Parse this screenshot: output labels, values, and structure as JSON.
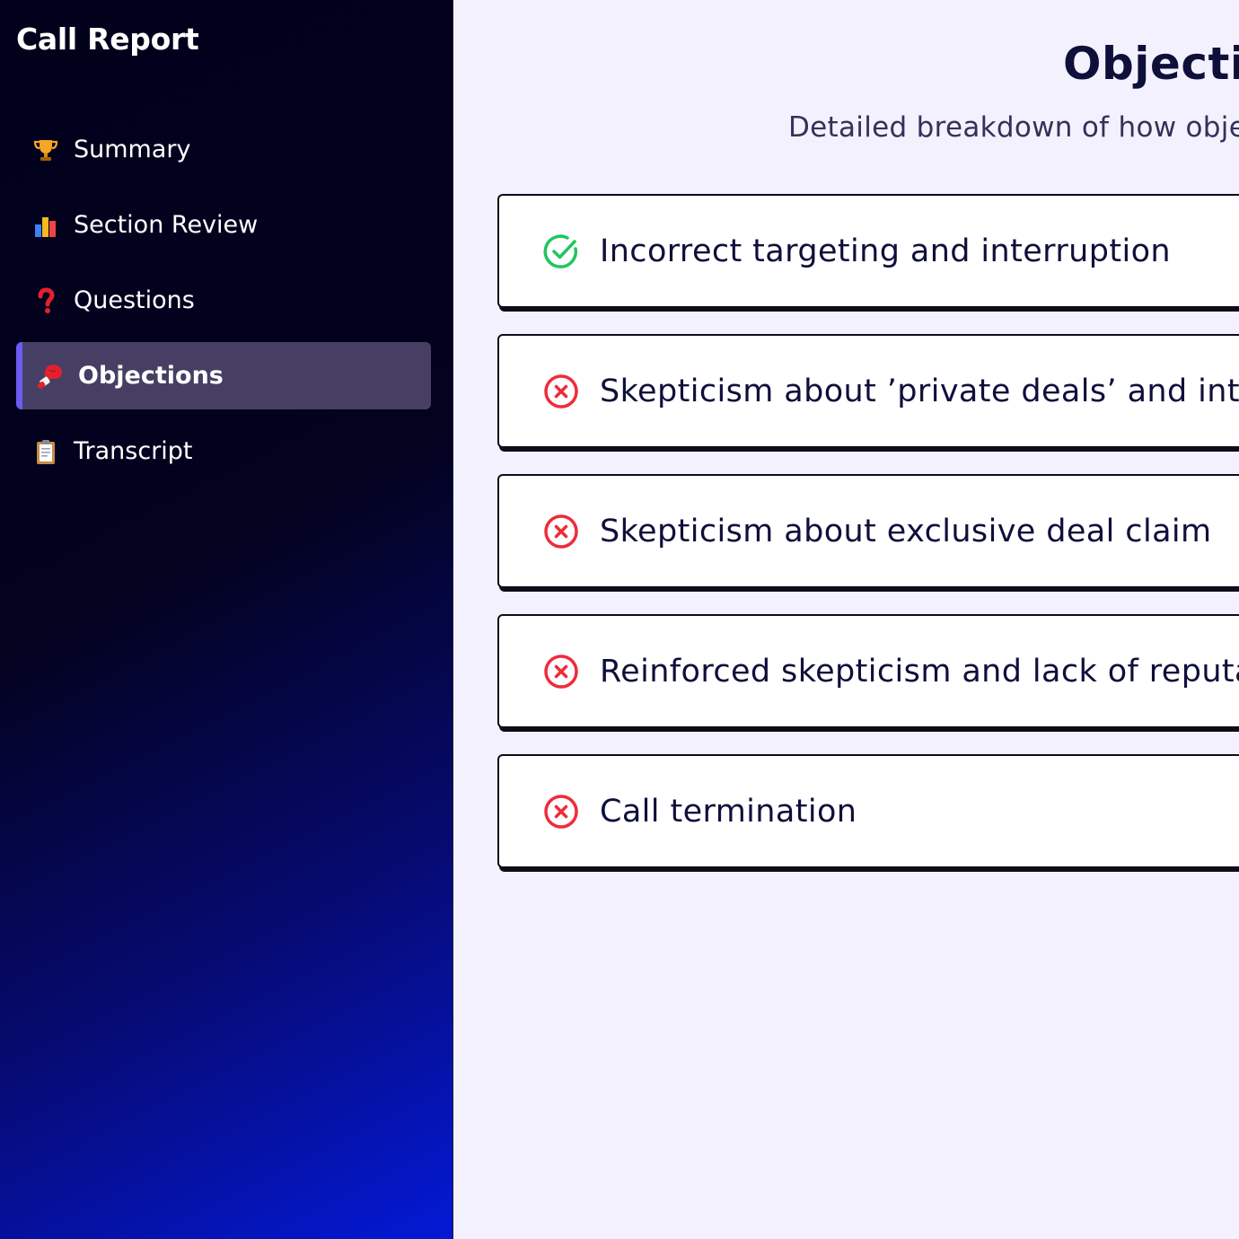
{
  "sidebar": {
    "title": "Call Report",
    "items": [
      {
        "label": "Summary",
        "icon": "trophy-icon",
        "active": false
      },
      {
        "label": "Section Review",
        "icon": "bar-chart-icon",
        "active": false
      },
      {
        "label": "Questions",
        "icon": "question-mark-icon",
        "active": false
      },
      {
        "label": "Objections",
        "icon": "boxing-glove-icon",
        "active": true
      },
      {
        "label": "Transcript",
        "icon": "clipboard-icon",
        "active": false
      }
    ]
  },
  "main": {
    "title": "Objectio",
    "subtitle": "Detailed breakdown of how objec",
    "objections": [
      {
        "title": "Incorrect targeting and interruption",
        "status": "handled",
        "icon": "check-circle-icon"
      },
      {
        "title": "Skepticism about ’private deals’ and integ",
        "status": "not-handled",
        "icon": "x-circle-icon"
      },
      {
        "title": "Skepticism about exclusive deal claim",
        "status": "not-handled",
        "icon": "x-circle-icon"
      },
      {
        "title": "Reinforced skepticism and lack of reputa",
        "status": "not-handled",
        "icon": "x-circle-icon"
      },
      {
        "title": "Call termination",
        "status": "not-handled",
        "icon": "x-circle-icon"
      }
    ]
  },
  "colors": {
    "sidebar_dark": "#02011c",
    "sidebar_blue": "#0419d6",
    "active_bg": "#463f63",
    "active_accent": "#6d5cf2",
    "main_bg": "#f4f1fe",
    "success": "#22c55e",
    "danger": "#ef2b3a",
    "text_dark": "#0e0f3b"
  }
}
